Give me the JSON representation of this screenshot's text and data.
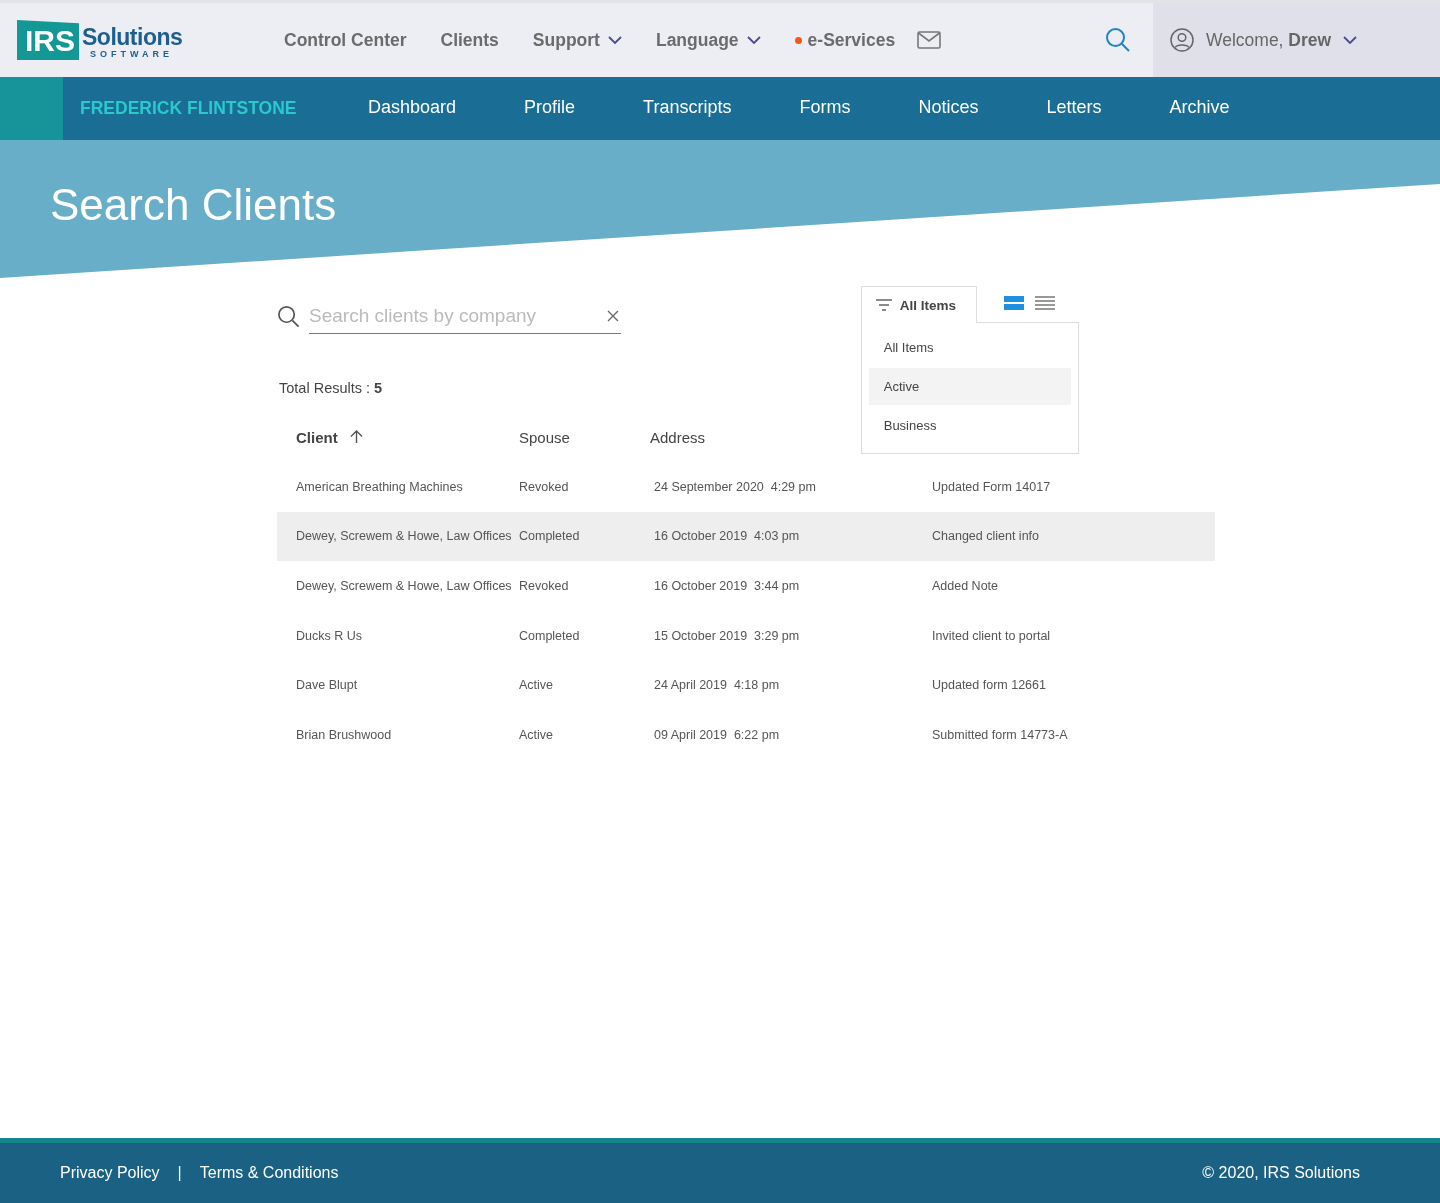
{
  "logo": {
    "mark": "IRS",
    "name": "Solutions",
    "tagline": "SOFTWARE"
  },
  "top_menu": [
    {
      "label": "Control Center",
      "kind": "link"
    },
    {
      "label": "Clients",
      "kind": "link"
    },
    {
      "label": "Support",
      "kind": "dropdown"
    },
    {
      "label": "Language",
      "kind": "dropdown"
    },
    {
      "label": "e-Services",
      "kind": "alert"
    }
  ],
  "user": {
    "greeting": "Welcome,",
    "name": "Drew"
  },
  "client_name": "FREDERICK FLINTSTONE",
  "tabs": [
    {
      "label": "Dashboard",
      "selected": false
    },
    {
      "label": "Profile",
      "selected": false
    },
    {
      "label": "Transcripts",
      "selected": false
    },
    {
      "label": "Forms",
      "selected": false
    },
    {
      "label": "Notices",
      "selected": false
    },
    {
      "label": "Letters",
      "selected": false
    },
    {
      "label": "Archive",
      "selected": false
    }
  ],
  "page_title": "Search Clients",
  "search": {
    "placeholder": "Search clients by company"
  },
  "total_results": {
    "label": "Total Results :",
    "count": "5"
  },
  "filter": {
    "label": "All Items",
    "expanded": true,
    "options": [
      {
        "label": "All Items",
        "selected": false
      },
      {
        "label": "Active",
        "selected": true
      },
      {
        "label": "Business",
        "selected": false
      }
    ]
  },
  "views": [
    {
      "kind": "cards",
      "selected": true
    },
    {
      "kind": "list",
      "selected": false
    }
  ],
  "table": {
    "columns": [
      {
        "label": "Client",
        "sorted": true
      },
      {
        "label": "Spouse",
        "sorted": false
      },
      {
        "label": "Address",
        "sorted": false
      }
    ],
    "rows": [
      {
        "cells": [
          "American Breathing Machines",
          "Revoked",
          "24 September 2020  4:29 pm",
          "Updated Form 14017"
        ],
        "selected": false
      },
      {
        "cells": [
          "Dewey, Screwem & Howe, Law Offices",
          "Completed",
          "16 October 2019  4:03 pm",
          "Changed client info"
        ],
        "selected": true
      },
      {
        "cells": [
          "Dewey, Screwem & Howe, Law Offices",
          "Revoked",
          "16 October 2019  3:44 pm",
          "Added Note"
        ],
        "selected": false
      },
      {
        "cells": [
          "Ducks R Us",
          "Completed",
          "15 October 2019  3:29 pm",
          "Invited client to portal"
        ],
        "selected": false
      },
      {
        "cells": [
          "Dave Blupt",
          "Active",
          "24 April 2019  4:18 pm",
          "Updated form 12661"
        ],
        "selected": false
      },
      {
        "cells": [
          "Brian Brushwood",
          "Active",
          "09 April 2019  6:22 pm",
          "Submitted form 14773-A"
        ],
        "selected": false
      }
    ]
  },
  "footer": {
    "links": [
      "Privacy Policy",
      "Terms & Conditions"
    ],
    "separator": "|",
    "copyright": "© 2020, IRS Solutions"
  }
}
